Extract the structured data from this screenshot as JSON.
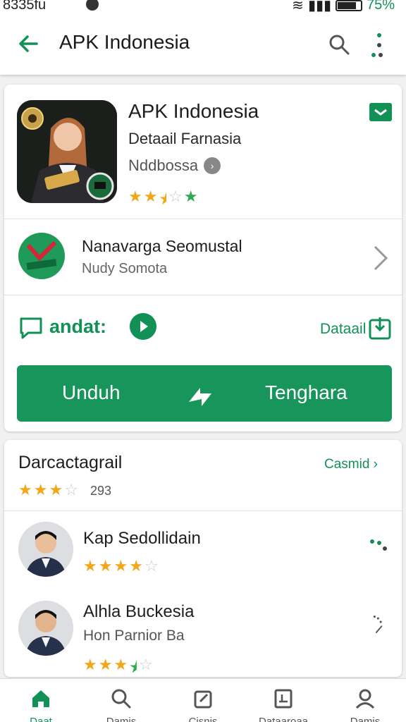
{
  "status": {
    "time": "8335fu",
    "battery": "75%"
  },
  "appbar": {
    "title": "APK Indonesia",
    "icons": [
      "back-arrow-icon",
      "search-icon",
      "more-vert-icon"
    ]
  },
  "app": {
    "name": "APK Indonesia",
    "subtitle": "Detaail Farnasia",
    "developer": "Nddbossa",
    "rating": 2.5
  },
  "publisher": {
    "name": "Nanavarga Seomustal",
    "subtitle": "Nudy Somota"
  },
  "ad_row": {
    "label": "andat:",
    "detail_label": "Dataail"
  },
  "download": {
    "left_label": "Unduh",
    "right_label": "Tenghara"
  },
  "reviews": {
    "title": "Darcactagrail",
    "link": "Casmid ›",
    "count": "293",
    "rating": 3,
    "items": [
      {
        "name": "Kap Sedollidain",
        "subtitle": "",
        "rating": 4
      },
      {
        "name": "Alhla Buckesia",
        "subtitle": "Hon Parnior Ba",
        "rating": 3.5
      }
    ]
  },
  "bottom_nav": [
    {
      "label": "Daat",
      "icon": "home-icon",
      "active": true
    },
    {
      "label": "Damis",
      "icon": "search-icon",
      "active": false
    },
    {
      "label": "Cisnis",
      "icon": "edit-icon",
      "active": false
    },
    {
      "label": "Dataaroaa",
      "icon": "document-icon",
      "active": false
    },
    {
      "label": "Damis",
      "icon": "profile-icon",
      "active": false
    }
  ],
  "colors": {
    "accent": "#129157",
    "star": "#f2a618"
  }
}
